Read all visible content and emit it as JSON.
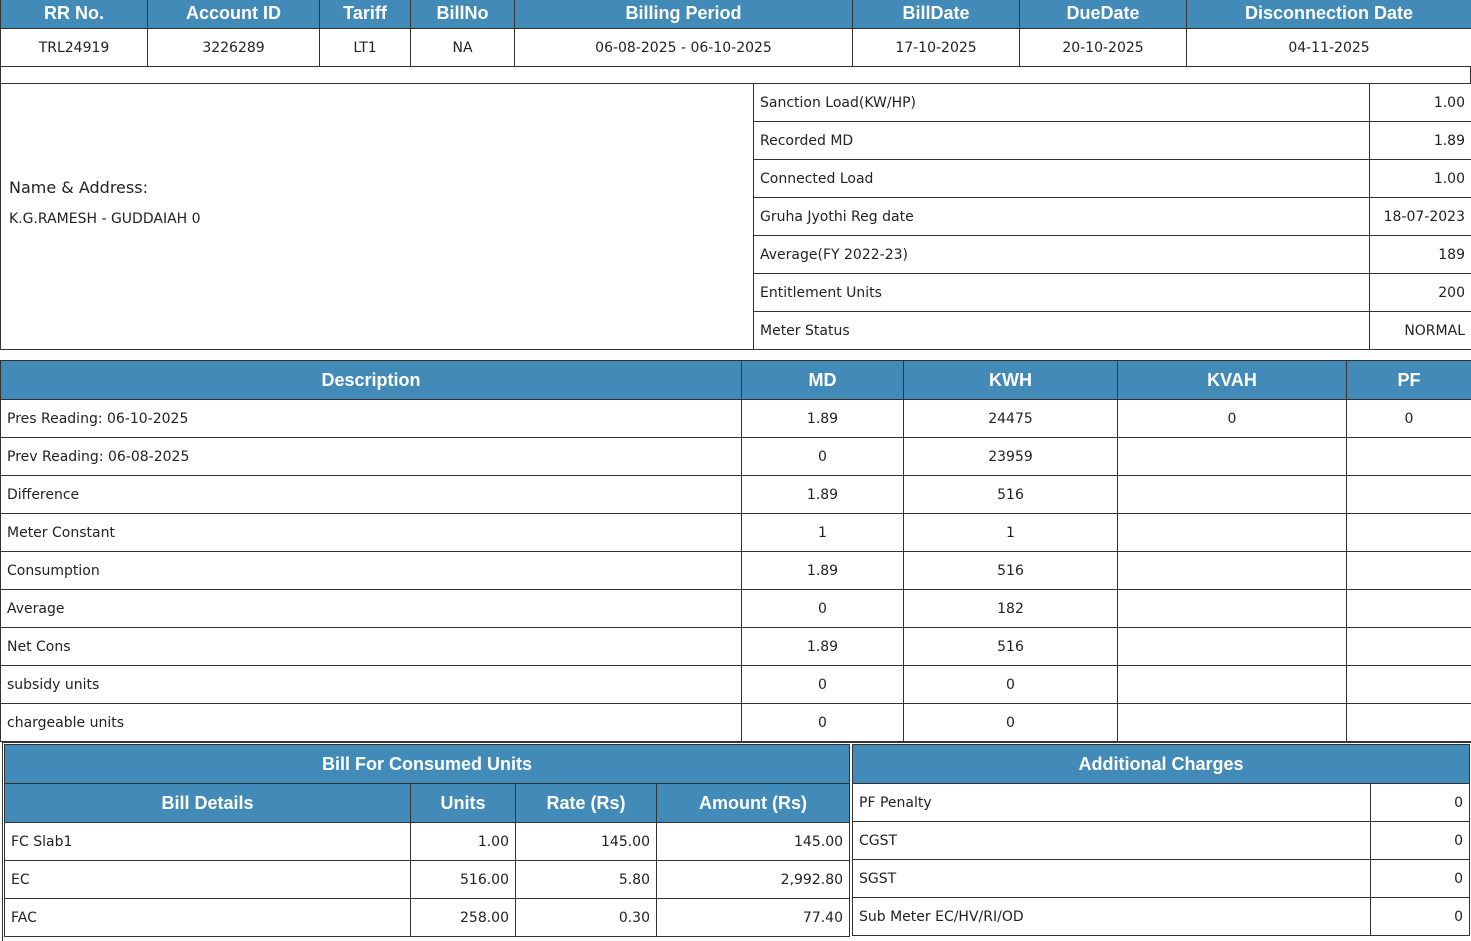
{
  "summary": {
    "headers": [
      "RR No.",
      "Account ID",
      "Tariff",
      "BillNo",
      "Billing Period",
      "BillDate",
      "DueDate",
      "Disconnection Date"
    ],
    "values": [
      "TRL24919",
      "3226289",
      "LT1",
      "NA",
      "06-08-2025 - 06-10-2025",
      "17-10-2025",
      "20-10-2025",
      "04-11-2025"
    ]
  },
  "customer": {
    "label": "Name & Address:",
    "name": "K.G.RAMESH - GUDDAIAH 0"
  },
  "info": [
    [
      "Sanction Load(KW/HP)",
      "1.00"
    ],
    [
      "Recorded MD",
      "1.89"
    ],
    [
      "Connected Load",
      "1.00"
    ],
    [
      "Gruha Jyothi Reg date",
      "18-07-2023"
    ],
    [
      "Average(FY 2022-23)",
      "189"
    ],
    [
      "Entitlement Units",
      "200"
    ],
    [
      "Meter Status",
      "NORMAL"
    ]
  ],
  "readings": {
    "headers": [
      "Description",
      "MD",
      "KWH",
      "KVAH",
      "PF"
    ],
    "rows": [
      [
        "Pres Reading: 06-10-2025",
        "1.89",
        "24475",
        "0",
        "0"
      ],
      [
        "Prev Reading: 06-08-2025",
        "0",
        "23959",
        "",
        ""
      ],
      [
        "Difference",
        "1.89",
        "516",
        "",
        ""
      ],
      [
        "Meter Constant",
        "1",
        "1",
        "",
        ""
      ],
      [
        "Consumption",
        "1.89",
        "516",
        "",
        ""
      ],
      [
        "Average",
        "0",
        "182",
        "",
        ""
      ],
      [
        "Net Cons",
        "1.89",
        "516",
        "",
        ""
      ],
      [
        "subsidy units",
        "0",
        "0",
        "",
        ""
      ],
      [
        "chargeable units",
        "0",
        "0",
        "",
        ""
      ]
    ]
  },
  "bill": {
    "title": "Bill For Consumed Units",
    "headers": [
      "Bill Details",
      "Units",
      "Rate (Rs)",
      "Amount (Rs)"
    ],
    "rows": [
      [
        "FC Slab1",
        "1.00",
        "145.00",
        "145.00"
      ],
      [
        "EC",
        "516.00",
        "5.80",
        "2,992.80"
      ],
      [
        "FAC",
        "258.00",
        "0.30",
        "77.40"
      ]
    ]
  },
  "additional": {
    "title": "Additional Charges",
    "rows": [
      [
        "PF Penalty",
        "0"
      ],
      [
        "CGST",
        "0"
      ],
      [
        "SGST",
        "0"
      ],
      [
        "Sub Meter EC/HV/RI/OD",
        "0"
      ]
    ]
  },
  "colors": {
    "header": "#428bb9"
  }
}
